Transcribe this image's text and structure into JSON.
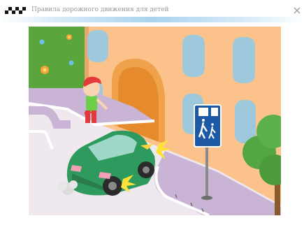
{
  "window": {
    "title": "Правила дорожного движения для детей",
    "logo_icon": "checkered-flag-icon",
    "close_icon": "close-icon"
  },
  "scene": {
    "sign_icon": "pedestrian-crossing-sign-icon",
    "colors": {
      "grass": "#5aa63c",
      "building": "#fbc28b",
      "arch": "#f0a24a",
      "window": "#9ec9dc",
      "sidewalk": "#c9b4d6",
      "curb": "#ffffff",
      "road": "#ede5ee",
      "car": "#2f9a5e",
      "sign": "#1c5aa6",
      "tree": "#53a642"
    }
  }
}
